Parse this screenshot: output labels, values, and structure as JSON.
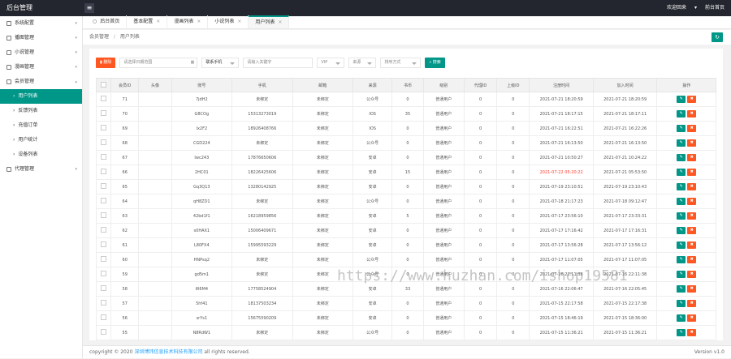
{
  "app": {
    "title": "后台管理",
    "toggle_icon": "≡",
    "user": "欢迎回来",
    "home": "前台首页"
  },
  "sidebar": {
    "items": [
      {
        "label": "系统配置",
        "icon": "gear-icon"
      },
      {
        "label": "播图管理",
        "icon": "image-icon"
      },
      {
        "label": "小说管理",
        "icon": "book-icon"
      },
      {
        "label": "漫画管理",
        "icon": "comic-icon"
      },
      {
        "label": "会员管理",
        "icon": "user-icon"
      }
    ],
    "subitems": [
      {
        "label": "用户列表",
        "active": true
      },
      {
        "label": "反馈列表",
        "active": false
      },
      {
        "label": "充值订单",
        "active": false
      },
      {
        "label": "用户统计",
        "active": false
      },
      {
        "label": "设备列表",
        "active": false
      }
    ],
    "last": {
      "label": "代理管理",
      "icon": "settings-icon"
    }
  },
  "tabs": [
    {
      "label": "后台首页",
      "close": false,
      "active": false
    },
    {
      "label": "基本配置",
      "close": true,
      "active": false
    },
    {
      "label": "漫画列表",
      "close": true,
      "active": false
    },
    {
      "label": "小说列表",
      "close": true,
      "active": false
    },
    {
      "label": "用户列表",
      "close": true,
      "active": true
    }
  ],
  "breadcrumb": {
    "root": "会员管理",
    "sep": "/",
    "current": "用户列表"
  },
  "toolbar": {
    "delete_label": "删除",
    "date_placeholder": "请选择日期范围",
    "phone_select": "联系手机",
    "keyword_placeholder": "请输入关键字",
    "vip_select": "VIP",
    "source_select": "来源",
    "sort_select": "排序方式",
    "search_label": "搜索"
  },
  "table": {
    "headers": [
      "会员ID",
      "头像",
      "账号",
      "手机",
      "邮箱",
      "来源",
      "书币",
      "级别",
      "代理ID",
      "上级ID",
      "注册时间",
      "加入时间",
      "操作"
    ],
    "rows": [
      [
        "71",
        "",
        "7jdH2",
        "未绑定",
        "未绑定",
        "公众号",
        "0",
        "普通用户",
        "0",
        "0",
        "2021-07-21 18:20:59",
        "2021-07-21 18:20:59"
      ],
      [
        "70",
        "",
        "G8COg",
        "15313273019",
        "未绑定",
        "IOS",
        "35",
        "普通用户",
        "0",
        "0",
        "2021-07-21 18:17:15",
        "2021-07-21 18:17:11"
      ],
      [
        "69",
        "",
        "Ix2F2",
        "18926408766",
        "未绑定",
        "IOS",
        "0",
        "普通用户",
        "0",
        "0",
        "2021-07-21 16:22:51",
        "2021-07-21 16:22:26"
      ],
      [
        "68",
        "",
        "CGD224",
        "未绑定",
        "未绑定",
        "公众号",
        "0",
        "普通用户",
        "0",
        "0",
        "2021-07-21 16:13:50",
        "2021-07-21 16:13:50"
      ],
      [
        "67",
        "",
        "Iwc243",
        "17876650606",
        "未绑定",
        "安卓",
        "0",
        "普通用户",
        "0",
        "0",
        "2021-07-21 10:50:27",
        "2021-07-21 10:24:22"
      ],
      [
        "66",
        "",
        "2HC01",
        "18226425606",
        "未绑定",
        "安卓",
        "15",
        "普通用户",
        "0",
        "0",
        "2021-07-22 05:20:22",
        "2021-07-21 05:53:50"
      ],
      [
        "65",
        "",
        "Gq3Q13",
        "13280142925",
        "未绑定",
        "安卓",
        "0",
        "普通用户",
        "0",
        "0",
        "2021-07-19 23:10:51",
        "2021-07-19 23:10:43"
      ],
      [
        "64",
        "",
        "qH8ZD1",
        "未绑定",
        "未绑定",
        "公众号",
        "0",
        "普通用户",
        "0",
        "0",
        "2021-07-18 21:17:23",
        "2021-07-18 09:12:47"
      ],
      [
        "63",
        "",
        "42bd1f1",
        "16218959856",
        "未绑定",
        "安卓",
        "5",
        "普通用户",
        "0",
        "0",
        "2021-07-17 23:56:10",
        "2021-07-17 23:33:31"
      ],
      [
        "62",
        "",
        "s0HAX1",
        "15006409671",
        "未绑定",
        "安卓",
        "0",
        "普通用户",
        "0",
        "0",
        "2021-07-17 17:16:42",
        "2021-07-17 17:16:31"
      ],
      [
        "61",
        "",
        "L80FX4",
        "15995593229",
        "未绑定",
        "安卓",
        "0",
        "普通用户",
        "0",
        "0",
        "2021-07-17 13:56:28",
        "2021-07-17 13:56:12"
      ],
      [
        "60",
        "",
        "HNPsq2",
        "未绑定",
        "未绑定",
        "公众号",
        "0",
        "普通用户",
        "0",
        "0",
        "2021-07-17 11:07:05",
        "2021-07-17 11:07:05"
      ],
      [
        "59",
        "",
        "gd5m1",
        "未绑定",
        "未绑定",
        "公众号",
        "0",
        "普通用户",
        "0",
        "0",
        "2021-07-16 22:11:38",
        "2021-07-16 22:11:38"
      ],
      [
        "58",
        "",
        "iR6M4",
        "17758524904",
        "未绑定",
        "安卓",
        "33",
        "普通用户",
        "0",
        "0",
        "2021-07-16 22:06:47",
        "2021-07-16 22:05:45"
      ],
      [
        "57",
        "",
        "5hf41",
        "18137503234",
        "未绑定",
        "安卓",
        "0",
        "普通用户",
        "0",
        "0",
        "2021-07-15 22:17:58",
        "2021-07-15 22:17:38"
      ],
      [
        "56",
        "",
        "srYs1",
        "15675590209",
        "未绑定",
        "安卓",
        "0",
        "普通用户",
        "0",
        "0",
        "2021-07-15 18:46:19",
        "2021-07-15 18:36:00"
      ],
      [
        "55",
        "",
        "N8RdW1",
        "未绑定",
        "未绑定",
        "公众号",
        "0",
        "普通用户",
        "0",
        "0",
        "2021-07-15 11:36:21",
        "2021-07-15 11:36:21"
      ]
    ]
  },
  "footer": {
    "prefix": "copyright © 2020",
    "company": "深圳博玮信息技术科技有限公司",
    "suffix": "all rights reserved.",
    "version": "Version v1.0"
  },
  "watermark": "https://www.huzhan.com/ishop19581",
  "colors": {
    "accent": "#009688",
    "danger": "#ff5722",
    "topbar": "#23262e"
  }
}
